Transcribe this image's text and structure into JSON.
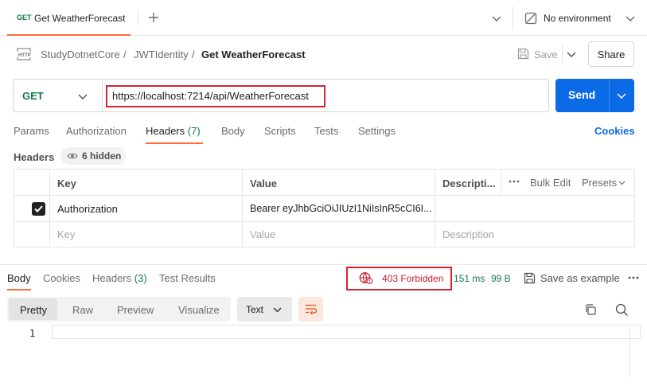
{
  "tab": {
    "method": "GET",
    "title": "Get WeatherForecast"
  },
  "environment": {
    "label": "No environment"
  },
  "breadcrumb": {
    "items": [
      "StudyDotnetCore",
      "JWTIdentity"
    ],
    "current": "Get WeatherForecast"
  },
  "toolbar": {
    "save_label": "Save",
    "share_label": "Share"
  },
  "request": {
    "method": "GET",
    "url": "https://localhost:7214/api/WeatherForecast",
    "send_label": "Send"
  },
  "request_tabs": [
    {
      "label": "Params"
    },
    {
      "label": "Authorization"
    },
    {
      "label": "Headers",
      "count": "(7)"
    },
    {
      "label": "Body"
    },
    {
      "label": "Scripts"
    },
    {
      "label": "Tests"
    },
    {
      "label": "Settings"
    }
  ],
  "cookies_link": "Cookies",
  "headers_section": {
    "label": "Headers",
    "hidden_count": "6 hidden"
  },
  "headers_table": {
    "columns": [
      "Key",
      "Value",
      "Descripti..."
    ],
    "bulk_edit": "Bulk Edit",
    "presets": "Presets",
    "rows": [
      {
        "checked": true,
        "key": "Authorization",
        "value": "Bearer eyJhbGciOiJIUzI1NiIsInR5cCI6I..."
      }
    ],
    "placeholders": {
      "key": "Key",
      "value": "Value",
      "description": "Description"
    }
  },
  "response": {
    "tabs": [
      {
        "label": "Body"
      },
      {
        "label": "Cookies"
      },
      {
        "label": "Headers",
        "count": "(3)"
      },
      {
        "label": "Test Results"
      }
    ],
    "status": "403 Forbidden",
    "time": "151 ms",
    "size": "99 B",
    "save_example": "Save as example",
    "view_modes": [
      "Pretty",
      "Raw",
      "Preview",
      "Visualize"
    ],
    "format": "Text",
    "line_numbers": [
      "1"
    ]
  },
  "colors": {
    "accent": "#ff6c37",
    "send_button": "#0b6be6",
    "get_method": "#0f7b45",
    "error": "#c71e2b",
    "highlight_box": "#d62530"
  },
  "icons": [
    "plus-icon",
    "chevron-down-icon",
    "no-environment-icon",
    "http-icon",
    "save-icon",
    "eye-icon",
    "more-icon",
    "globe-error-icon",
    "wrap-lines-icon",
    "copy-icon",
    "search-icon"
  ]
}
